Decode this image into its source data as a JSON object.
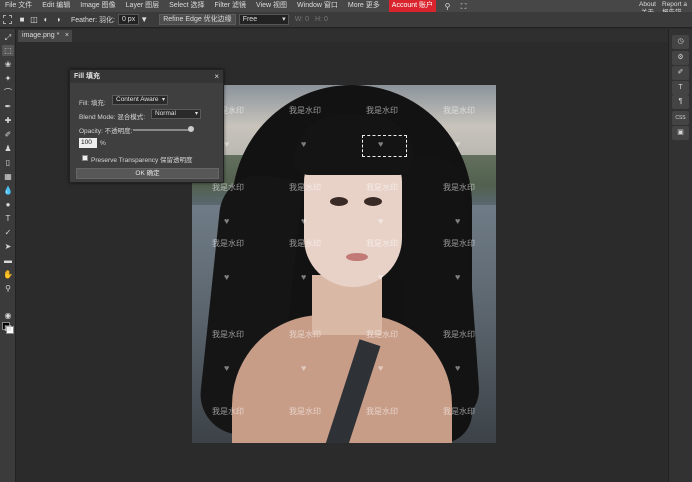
{
  "menu": {
    "items": [
      "File 文件",
      "Edit 编辑",
      "Image 图像",
      "Layer 图层",
      "Select 选择",
      "Filter 滤镜",
      "View 视图",
      "Window 窗口",
      "More 更多"
    ],
    "account": "Account 账户",
    "about_en": "About",
    "about_zh": "关于",
    "report_en": "Report a",
    "report_zh": "报告错"
  },
  "options": {
    "feather_label": "Feather: 羽化:",
    "feather_value": "0 px",
    "refine_edge": "Refine Edge 优化边缘",
    "style_value": "Free",
    "w_label": "W:",
    "w_value": "0",
    "h_label": "H:",
    "h_value": "0"
  },
  "tab": {
    "title": "image.png *",
    "close": "×"
  },
  "canvas": {
    "watermark_text": "我是水印"
  },
  "dialog": {
    "title": "Fill 填充",
    "close": "×",
    "fill_label": "Fill: 填充:",
    "fill_value": "Content Aware",
    "blend_label": "Blend Mode: 混合模式:",
    "blend_value": "Normal",
    "opacity_label": "Opacity: 不透明度:",
    "opacity_value": "100",
    "opacity_unit": "%",
    "opacity_level": 1.0,
    "preserve_label": "Preserve Transparency 保留透明度",
    "ok_label": "OK 确定"
  },
  "rightpanel": {
    "items": [
      "history-icon",
      "settings-icon",
      "brush-icon",
      "text-icon",
      "paragraph-icon",
      "css-icon",
      "image-icon"
    ]
  }
}
